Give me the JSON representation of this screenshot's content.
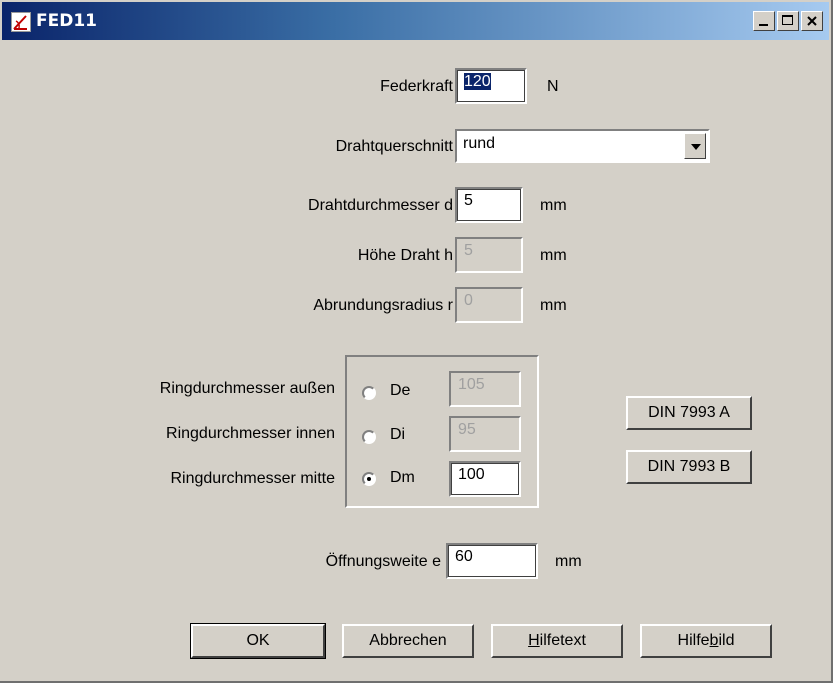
{
  "window": {
    "title": "FED11",
    "controls": {
      "minimize": "_",
      "maximize": "□",
      "close": "×"
    }
  },
  "form": {
    "federkraft": {
      "label": "Federkraft",
      "value": "120",
      "unit": "N"
    },
    "drahtquerschnitt": {
      "label": "Drahtquerschnitt",
      "selected": "rund"
    },
    "drahtdurchmesser": {
      "label": "Drahtdurchmesser d",
      "value": "5",
      "unit": "mm"
    },
    "hoehe": {
      "label": "Höhe Draht h",
      "value": "5",
      "unit": "mm"
    },
    "abrundungsradius": {
      "label": "Abrundungsradius r",
      "value": "0",
      "unit": "mm"
    },
    "ring": {
      "aussen": {
        "label": "Ringdurchmesser außen",
        "radio_label": "De",
        "value": "105",
        "checked": false
      },
      "innen": {
        "label": "Ringdurchmesser innen",
        "radio_label": "Di",
        "value": "95",
        "checked": false
      },
      "mitte": {
        "label": "Ringdurchmesser mitte",
        "radio_label": "Dm",
        "value": "100",
        "checked": true
      }
    },
    "oeffnungsweite": {
      "label": "Öffnungsweite e",
      "value": "60",
      "unit": "mm"
    }
  },
  "buttons": {
    "din_a": "DIN 7993 A",
    "din_b": "DIN 7993 B",
    "ok": "OK",
    "abbrechen": "Abbrechen",
    "hilfetext_pre": "",
    "hilfetext_ul": "H",
    "hilfetext_post": "ilfetext",
    "hilfebild_pre": "Hilfe",
    "hilfebild_ul": "b",
    "hilfebild_post": "ild"
  }
}
